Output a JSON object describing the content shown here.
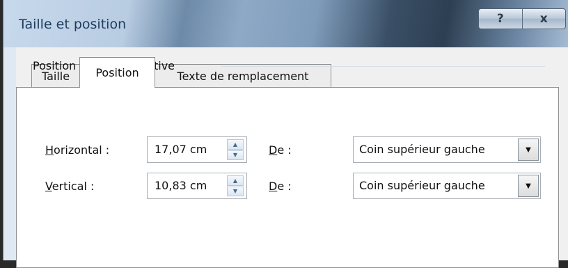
{
  "window": {
    "title": "Taille et position"
  },
  "title_buttons": {
    "help": "?",
    "close": "x"
  },
  "tabs": [
    {
      "label": "Taille"
    },
    {
      "label": "Position"
    },
    {
      "label": "Texte de remplacement"
    }
  ],
  "group": {
    "label": "Position sur la diapositive"
  },
  "horizontal": {
    "label_first": "H",
    "label_rest": "orizontal :",
    "value": "17,07 cm",
    "from_first": "D",
    "from_rest": "e :",
    "from_value": "Coin supérieur gauche"
  },
  "vertical": {
    "label_first": "V",
    "label_rest": "ertical :",
    "value": "10,83 cm",
    "from_first": "D",
    "from_rest": "e :",
    "from_value": "Coin supérieur gauche"
  },
  "glyphs": {
    "spin_up": "▲",
    "spin_down": "▼",
    "dropdown": "▼"
  }
}
